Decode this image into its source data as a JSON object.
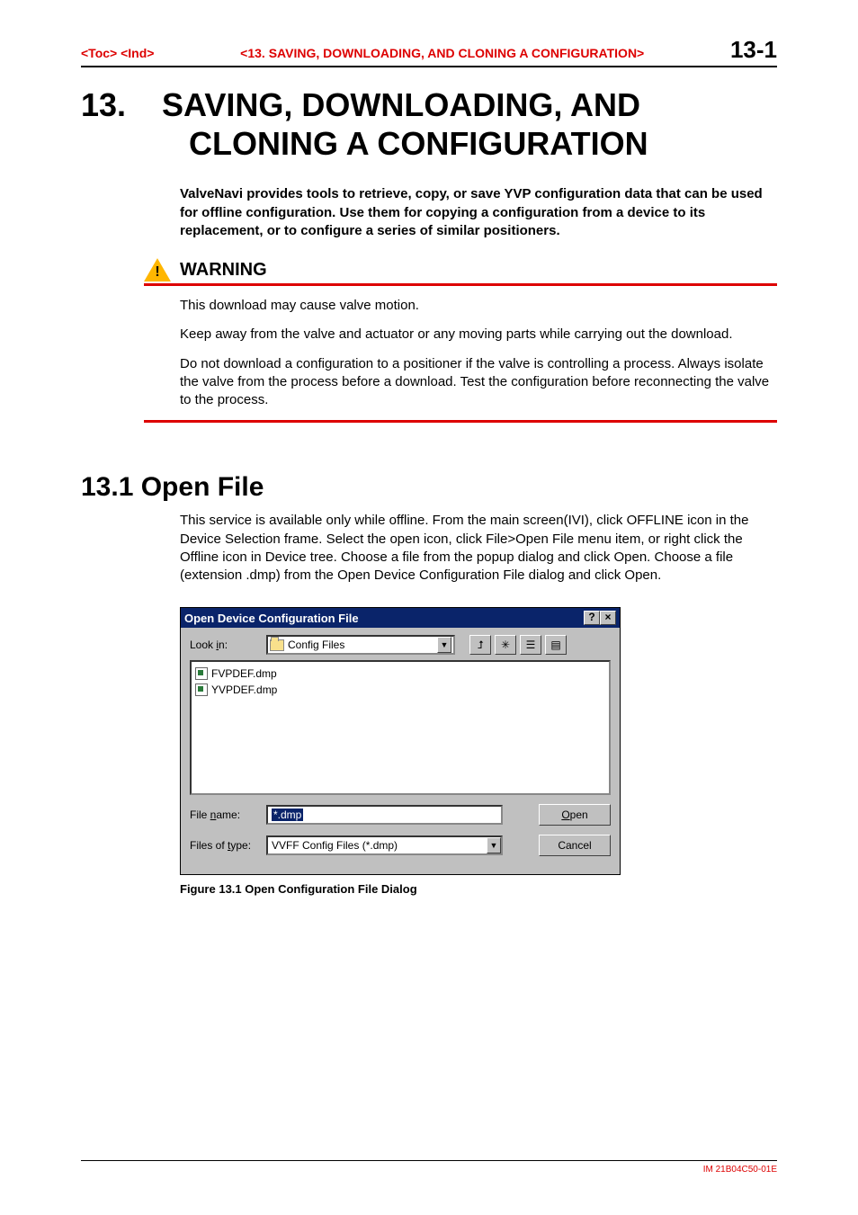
{
  "header": {
    "toc": "<Toc>",
    "ind": "<Ind>",
    "chapter_label": "<13.  SAVING, DOWNLOADING, AND CLONING A CONFIGURATION>",
    "page_number": "13-1"
  },
  "title": {
    "number": "13.",
    "line1": "SAVING, DOWNLOADING, AND",
    "line2": "CLONING A CONFIGURATION"
  },
  "intro_text": "ValveNavi provides tools to retrieve, copy, or save YVP configuration data that can be used for offline configuration.  Use them for copying a configuration from a device to its replacement, or to configure a series of similar positioners.",
  "warning": {
    "label": "WARNING",
    "p1": "This download may cause valve motion.",
    "p2": "Keep away from the valve and actuator or any moving parts while carrying out the download.",
    "p3": "Do not download a configuration to a positioner if the valve is controlling a process.  Always isolate the valve from the process before a download.  Test the configuration before reconnecting the valve to the process."
  },
  "section": {
    "heading": "13.1  Open File",
    "body": "This service is available only while offline.  From the main screen(IVI), click OFFLINE icon in the Device Selection frame.  Select the open icon, click File>Open File menu item, or right click the Offline icon in Device tree.  Choose a file from the popup dialog and click Open.  Choose a file (extension .dmp) from the Open Device Configuration File dialog and click Open."
  },
  "dialog": {
    "title": "Open Device Configuration File",
    "help_btn": "?",
    "close_btn": "×",
    "look_in_label_pre": "Look ",
    "look_in_label_ul": "i",
    "look_in_label_post": "n:",
    "look_in_value": "Config Files",
    "drop_arrow": "▼",
    "tool_up": "⮥",
    "tool_new": "✳",
    "tool_list": "☰",
    "tool_details": "▤",
    "files": [
      {
        "name": "FVPDEF.dmp"
      },
      {
        "name": "YVPDEF.dmp"
      }
    ],
    "file_name_label_pre": "File ",
    "file_name_label_ul": "n",
    "file_name_label_post": "ame:",
    "file_name_value": "*.dmp",
    "files_type_label_pre": "Files of ",
    "files_type_label_ul": "t",
    "files_type_label_post": "ype:",
    "files_type_value": "VVFF Config Files (*.dmp)",
    "open_ul": "O",
    "open_post": "pen",
    "cancel": "Cancel"
  },
  "figure_caption": "Figure 13.1 Open Configuration File Dialog",
  "footer_code": "IM 21B04C50-01E"
}
